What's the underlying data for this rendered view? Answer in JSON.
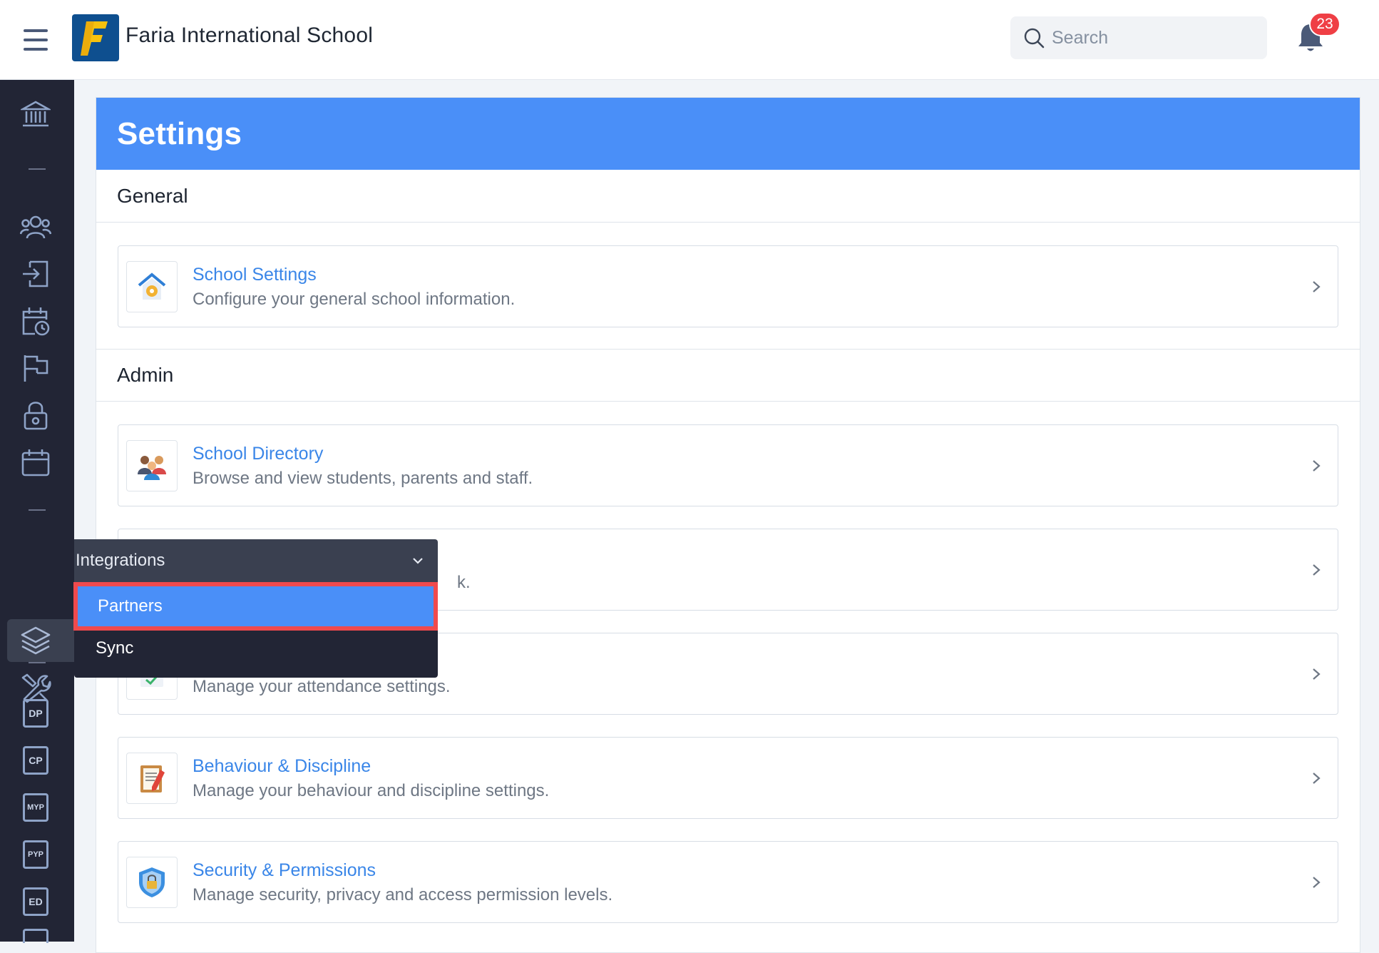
{
  "app": {
    "school_name": "Faria International School",
    "logo_letter": "F"
  },
  "header": {
    "search_placeholder": "Search",
    "notifications_count": "23"
  },
  "rail": {
    "icons": [
      "school-icon",
      "users-icon",
      "sign-in-icon",
      "calendar-clock-icon",
      "flag-icon",
      "lock-icon",
      "calendar-icon",
      "layers-icon",
      "tools-icon",
      "dp-icon",
      "cp-icon",
      "myp-icon",
      "pyp-icon",
      "ed-icon"
    ],
    "programmes": [
      "DP",
      "CP",
      "MYP",
      "PYP",
      "ED"
    ]
  },
  "page": {
    "title": "Settings",
    "sections": [
      {
        "title": "General",
        "tiles": [
          {
            "title": "School Settings",
            "description": "Configure your general school information."
          }
        ]
      },
      {
        "title": "Admin",
        "tiles": [
          {
            "title": "School Directory",
            "description": "Browse and view students, parents and staff."
          },
          {
            "title": "",
            "description": "k."
          },
          {
            "title": "",
            "description": "Manage your attendance settings."
          },
          {
            "title": "Behaviour & Discipline",
            "description": "Manage your behaviour and discipline settings."
          },
          {
            "title": "Security & Permissions",
            "description": "Manage security, privacy and access permission levels."
          }
        ]
      }
    ]
  },
  "flyout": {
    "title": "Integrations",
    "items": [
      {
        "label": "Partners",
        "active": true
      },
      {
        "label": "Sync",
        "active": false
      }
    ]
  },
  "colors": {
    "accent": "#4a8ff8",
    "rail_bg": "#222535",
    "highlight_outline": "#f04a4d",
    "link": "#3a86e8",
    "badge": "#ef3f45"
  }
}
